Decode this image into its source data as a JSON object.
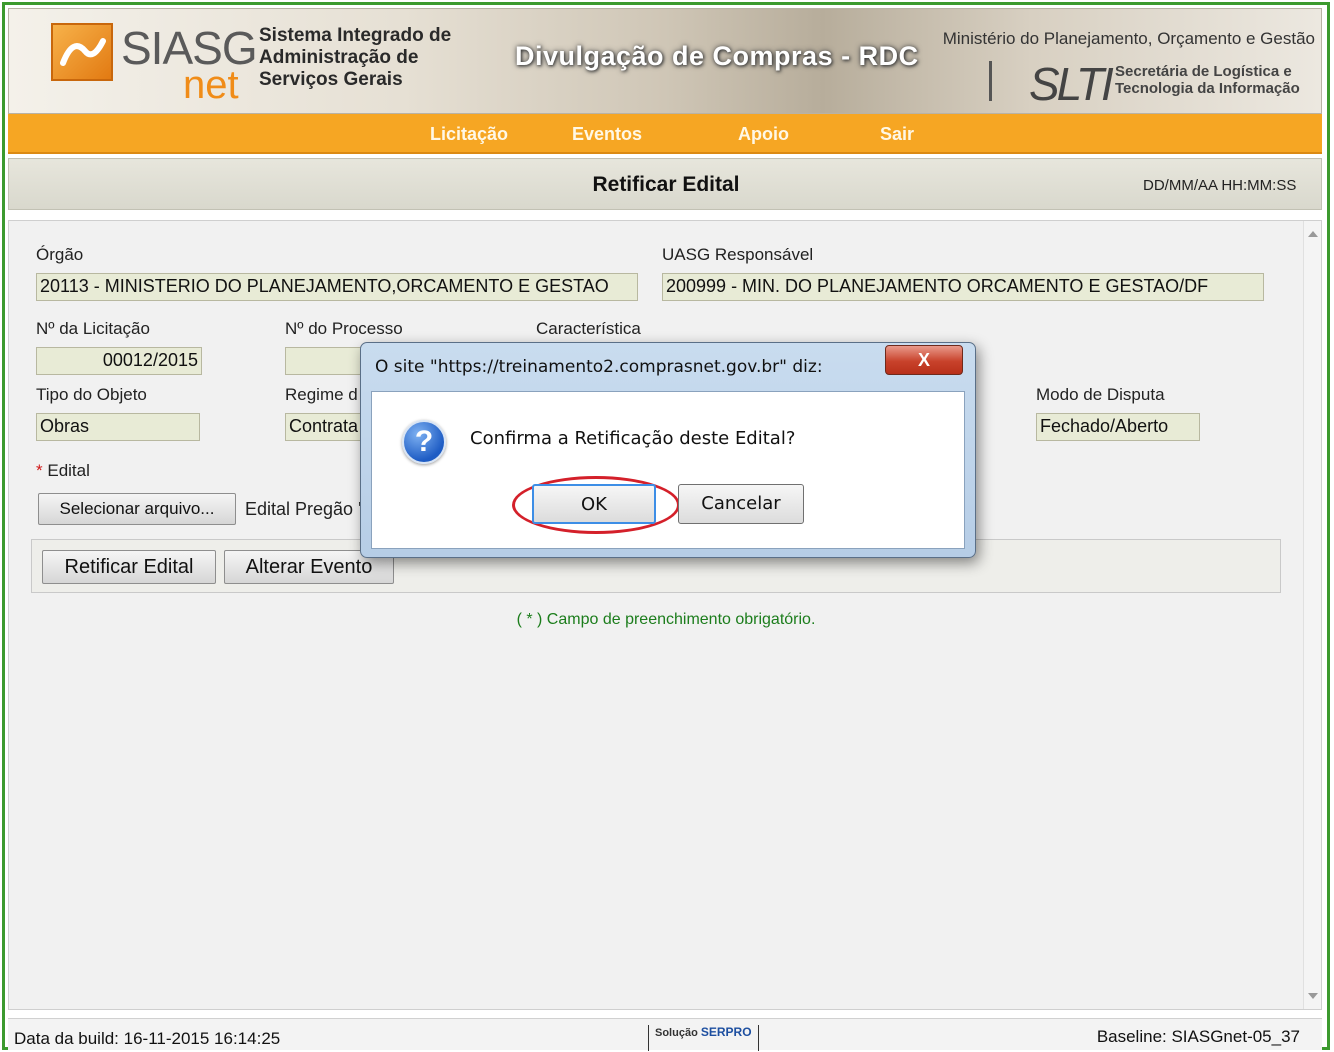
{
  "header": {
    "logo_siasg": "SIASG",
    "logo_net": "net",
    "system_name": [
      "Sistema Integrado de",
      "Administração de",
      "Serviços Gerais"
    ],
    "banner_title": "Divulgação de Compras - RDC",
    "ministry": "Ministério do Planejamento, Orçamento e Gestão",
    "slti": "SLTI",
    "slti_subtitle": [
      "Secretária de Logística e",
      "Tecnologia da Informação"
    ]
  },
  "menu": {
    "items": [
      {
        "label": "Licitação"
      },
      {
        "label": "Eventos"
      },
      {
        "label": "Apoio"
      },
      {
        "label": "Sair"
      }
    ]
  },
  "page": {
    "title": "Retificar Edital",
    "datetime": "DD/MM/AA HH:MM:SS"
  },
  "form": {
    "orgao_label": "Órgão",
    "orgao_value": "20113 - MINISTERIO DO PLANEJAMENTO,ORCAMENTO E GESTAO",
    "uasg_label": "UASG Responsável",
    "uasg_value": "200999 - MIN. DO PLANEJAMENTO ORCAMENTO E GESTAO/DF",
    "licitacao_label": "Nº da Licitação",
    "licitacao_value": "00012/2015",
    "processo_label": "Nº do Processo",
    "caracteristica_label": "Característica",
    "tipo_objeto_label": "Tipo do Objeto",
    "tipo_objeto_value": "Obras",
    "regime_label": "Regime d",
    "regime_value": "Contrata",
    "modo_disputa_label": "Modo de Disputa",
    "modo_disputa_value": "Fechado/Aberto",
    "edital_required": "*",
    "edital_label": "Edital",
    "select_file_button": "Selecionar arquivo...",
    "file_name": "Edital Pregão '"
  },
  "actions": {
    "retificar_button": "Retificar Edital",
    "alterar_button": "Alterar Evento"
  },
  "note": {
    "text": "( * ) Campo de preenchimento obrigatório."
  },
  "dialog": {
    "title": "O site \"https://treinamento2.comprasnet.gov.br\" diz:",
    "close_label": "X",
    "question_icon": "?",
    "message": "Confirma a Retificação deste Edital?",
    "ok_label": "OK",
    "cancel_label": "Cancelar"
  },
  "footer": {
    "build": "Data da build: 16-11-2015 16:14:25",
    "serpro_prefix": "Solução",
    "serpro_name": "SERPRO",
    "baseline": "Baseline: SIASGnet-05_37"
  },
  "colors": {
    "menu_orange": "#f6a623",
    "frame_green": "#3c9a2e",
    "note_green": "#1c7d1c",
    "required_red": "#d01818",
    "highlight_ring": "#d4202a"
  }
}
